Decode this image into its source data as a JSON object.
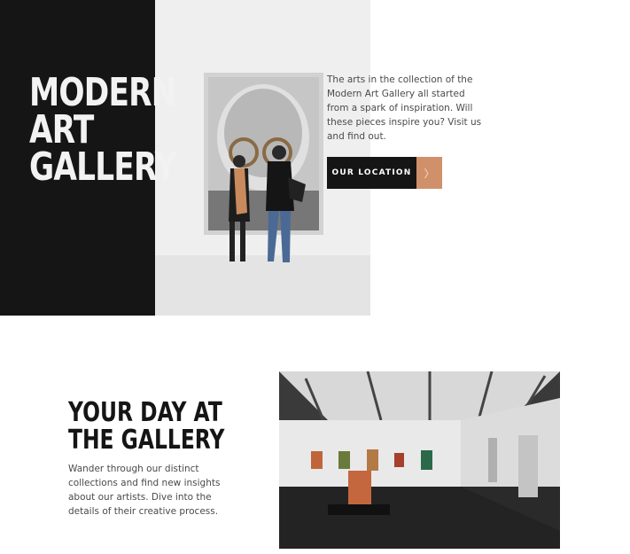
{
  "hero": {
    "title": "MODERN\nART GALLERY",
    "description": "The arts in the collection of the Modern Art Gallery all started from a spark of inspiration. Will these pieces inspire you? Visit us and find out.",
    "cta_label": "OUR LOCATION",
    "cta_arrow": "〉",
    "accent_color": "#d0906a",
    "dark_color": "#151515"
  },
  "gallery_section": {
    "title": "YOUR DAY AT\nTHE GALLERY",
    "description": "Wander through our distinct collections and find new insights about our artists. Dive into the details of their creative process."
  }
}
